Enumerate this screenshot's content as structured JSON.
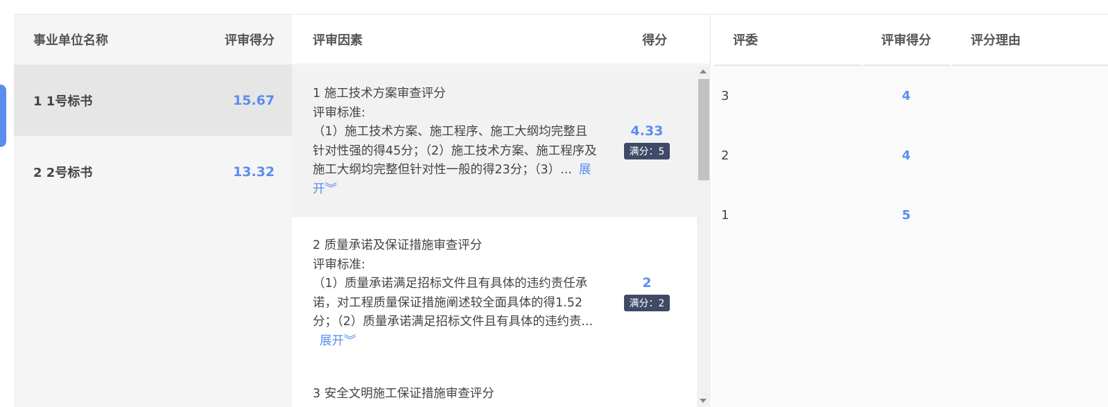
{
  "units_table": {
    "headers": {
      "name": "事业单位名称",
      "score": "评审得分"
    },
    "rows": [
      {
        "name": "1 1号标书",
        "score": "15.67"
      },
      {
        "name": "2 2号标书",
        "score": "13.32"
      }
    ]
  },
  "factors_table": {
    "headers": {
      "factor": "评审因素",
      "score": "得分"
    },
    "expand_label": "展开",
    "items": [
      {
        "title": "1 施工技术方案审查评分",
        "criteria_label": "评审标准:",
        "desc": "（1）施工技术方案、施工程序、施工大纲均完整且针对性强的得45分；（2）施工技术方案、施工程序及施工大纲均完整但针对性一般的得23分；（3）...",
        "score": "4.33",
        "full_score": "满分：5"
      },
      {
        "title": "2 质量承诺及保证措施审查评分",
        "criteria_label": "评审标准:",
        "desc": "（1）质量承诺满足招标文件且有具体的违约责任承诺，对工程质量保证措施阐述较全面具体的得1.52分；（2）质量承诺满足招标文件且有具体的违约责...",
        "score": "2",
        "full_score": "满分：2"
      },
      {
        "title": "3 安全文明施工保证措施审查评分"
      }
    ]
  },
  "judges_table": {
    "headers": {
      "judge": "评委",
      "score": "评审得分",
      "reason": "评分理由"
    },
    "rows": [
      {
        "judge": "3",
        "score": "4",
        "reason": ""
      },
      {
        "judge": "2",
        "score": "4",
        "reason": ""
      },
      {
        "judge": "1",
        "score": "5",
        "reason": ""
      }
    ]
  },
  "colors": {
    "accent": "#5b8def",
    "badge": "#3e4a66"
  }
}
